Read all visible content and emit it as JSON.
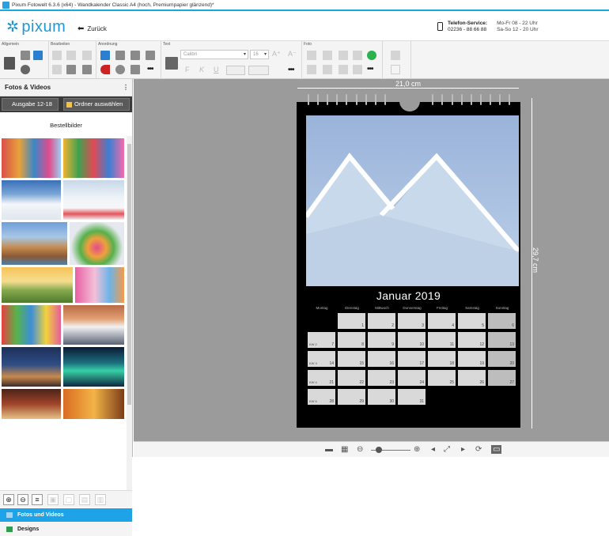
{
  "window": {
    "title": "Pixum Fotowelt 6.3.6 (x64) - Wandkalender Classic A4 (hoch, Premiumpapier glänzend)*"
  },
  "header": {
    "logo_text": "pixum",
    "back_label": "Zurück",
    "service_label": "Telefon-Service:",
    "service_phone": "02236 - 88 66 88",
    "hours_weekday": "Mo-Fr 08 - 22 Uhr",
    "hours_weekend": "Sa-So 12 - 20 Uhr"
  },
  "ribbon": {
    "groups": [
      "Allgemein",
      "Bearbeiten",
      "Anordnung",
      "Text",
      "Foto"
    ],
    "font_name": "Calibri",
    "font_size": "16",
    "bold_label": "F",
    "italic_label": "K",
    "underline_label": "U",
    "more": "•••"
  },
  "sidebar": {
    "title": "Fotos & Videos",
    "menu_dots": "⋮",
    "source_button": "Ausgabe 12-18",
    "folder_button": "Ordner auswählen",
    "order_label": "Bestellbilder",
    "nav_photos": "Fotos und Videos",
    "nav_designs": "Designs"
  },
  "canvas": {
    "width_label": "21,0 cm",
    "height_label": "29,7 cm"
  },
  "calendar": {
    "month": "Januar 2019",
    "weekdays": [
      "Montag",
      "Dienstag",
      "Mittwoch",
      "Donnerstag",
      "Freitag",
      "Samstag",
      "Sonntag"
    ],
    "week_labels": [
      "KW 1",
      "KW 2",
      "KW 3",
      "KW 4",
      "KW 5"
    ],
    "days": [
      "1",
      "2",
      "3",
      "4",
      "5",
      "6",
      "7",
      "8",
      "9",
      "10",
      "11",
      "12",
      "13",
      "14",
      "15",
      "16",
      "17",
      "18",
      "19",
      "20",
      "21",
      "22",
      "23",
      "24",
      "25",
      "26",
      "27",
      "28",
      "29",
      "30",
      "31"
    ]
  },
  "colors": {
    "accent": "#1fa3e8",
    "logo": "#1f97d4",
    "canvas_bg": "#9b9b9b",
    "calendar_bg": "#000000"
  }
}
